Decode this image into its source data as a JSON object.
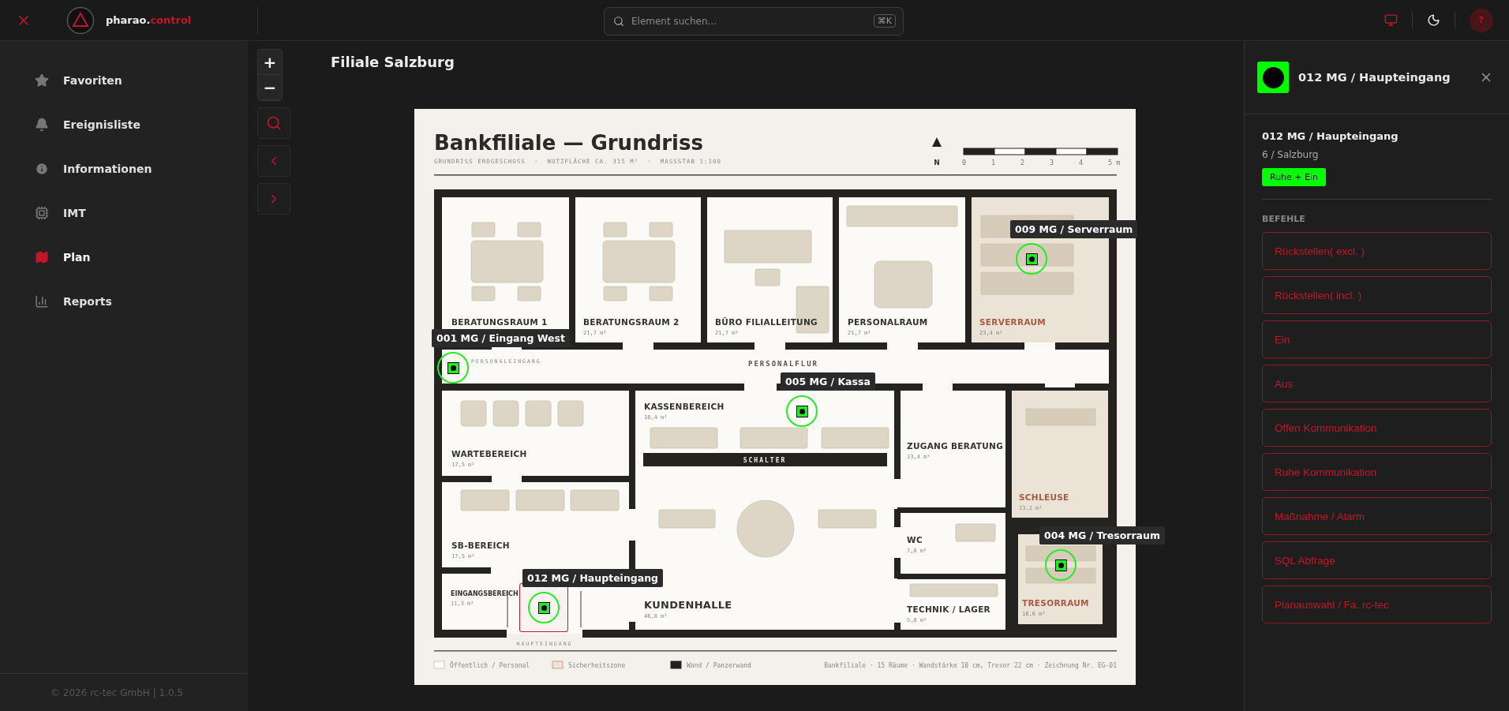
{
  "topbar": {
    "brand_prefix": "pharao.",
    "brand_suffix": "control",
    "search": {
      "placeholder": "Element suchen...",
      "shortcut": "⌘K"
    },
    "help": "?"
  },
  "sidebar": {
    "items": [
      {
        "label": "Favoriten",
        "selected": false
      },
      {
        "label": "Ereignisliste",
        "selected": false
      },
      {
        "label": "Informationen",
        "selected": false
      },
      {
        "label": "IMT",
        "selected": false
      },
      {
        "label": "Plan",
        "selected": true
      },
      {
        "label": "Reports",
        "selected": false
      }
    ],
    "footer": "© 2026 rc-tec GmbH | 1.0.5"
  },
  "map": {
    "zoom_in": "+",
    "zoom_out": "−",
    "title": "Filiale Salzburg",
    "plan": {
      "title": "Bankfiliale — Grundriss",
      "subtitle": "GRUNDRISS ERDGESCHOSS  ·  NUTZFLÄCHE CA. 315 M²  ·  MASSSTAB 1:100",
      "north": "N",
      "scale_ticks": [
        "0",
        "1",
        "2",
        "3",
        "4",
        "5 m"
      ],
      "rooms": [
        {
          "name": "BERATUNGSRAUM 1",
          "kind": "normal"
        },
        {
          "name": "BERATUNGSRAUM 2",
          "area": "21,7 m²",
          "kind": "normal"
        },
        {
          "name": "BÜRO FILIALLEITUNG",
          "area": "21,7 m²",
          "kind": "normal"
        },
        {
          "name": "PERSONALRAUM",
          "area": "21,7 m²",
          "kind": "normal"
        },
        {
          "name": "SERVERRAUM",
          "area": "23,4 m²",
          "kind": "secure"
        },
        {
          "name": "KASSENBEREICH",
          "area": "18,4 m²",
          "kind": "normal"
        },
        {
          "name": "WARTEBEREICH",
          "area": "17,5 m²",
          "kind": "normal"
        },
        {
          "name": "ZUGANG BERATUNG",
          "area": "13,4 m²",
          "kind": "normal"
        },
        {
          "name": "SCHLEUSE",
          "area": "13,2 m²",
          "kind": "secure"
        },
        {
          "name": "SB-BEREICH",
          "area": "17,5 m²",
          "kind": "normal"
        },
        {
          "name": "WC",
          "area": "7,8 m²",
          "kind": "normal"
        },
        {
          "name": "EINGANGSBEREICH",
          "area": "11,3 m²",
          "kind": "normal"
        },
        {
          "name": "KUNDENHALLE",
          "area": "46,8 m²",
          "kind": "normal"
        },
        {
          "name": "TECHNIK / LAGER",
          "area": "5,8 m²",
          "kind": "normal"
        },
        {
          "name": "TRESORRAUM",
          "area": "18,6 m²",
          "kind": "secure"
        }
      ],
      "annotations": [
        "PERSONALFLUR",
        "PERSONALEINGANG",
        "HAUPTEINGANG",
        "SCHALTER"
      ],
      "legend": [
        {
          "label": "Öffentlich / Personal",
          "kind": "public"
        },
        {
          "label": "Sicherheitszone",
          "kind": "secure"
        },
        {
          "label": "Wand / Panzerwand",
          "kind": "wall"
        }
      ],
      "note": "Bankfiliale · 15 Räume · Wandstärke 10 cm, Tresor 22 cm · Zeichnung Nr. EG-01"
    },
    "markers": [
      {
        "label": "001 MG / Eingang West",
        "color": "#22ee22",
        "selected": false
      },
      {
        "label": "009 MG / Serverraum",
        "color": "#22ee22",
        "selected": false
      },
      {
        "label": "005 MG / Kassa",
        "color": "#22ee22",
        "selected": false
      },
      {
        "label": "004 MG / Tresorraum",
        "color": "#22ee22",
        "selected": false
      },
      {
        "label": "012 MG / Haupteingang",
        "color": "#22ee22",
        "selected": true
      }
    ]
  },
  "detail": {
    "title": "012 MG / Haupteingang",
    "name": "012 MG / Haupteingang",
    "location": "6 / Salzburg",
    "status": {
      "label": "Ruhe + Ein",
      "color": "#00ff00"
    },
    "section": "BEFEHLE",
    "commands": [
      "Rückstellen( excl. )",
      "Rückstellen( incl. )",
      "Ein",
      "Aus",
      "Offen Kommunikation",
      "Ruhe Kommunikation",
      "Maßnahme / Alarm",
      "SQL Abfrage",
      "Planauswahl / Fa. rc-tec"
    ]
  }
}
